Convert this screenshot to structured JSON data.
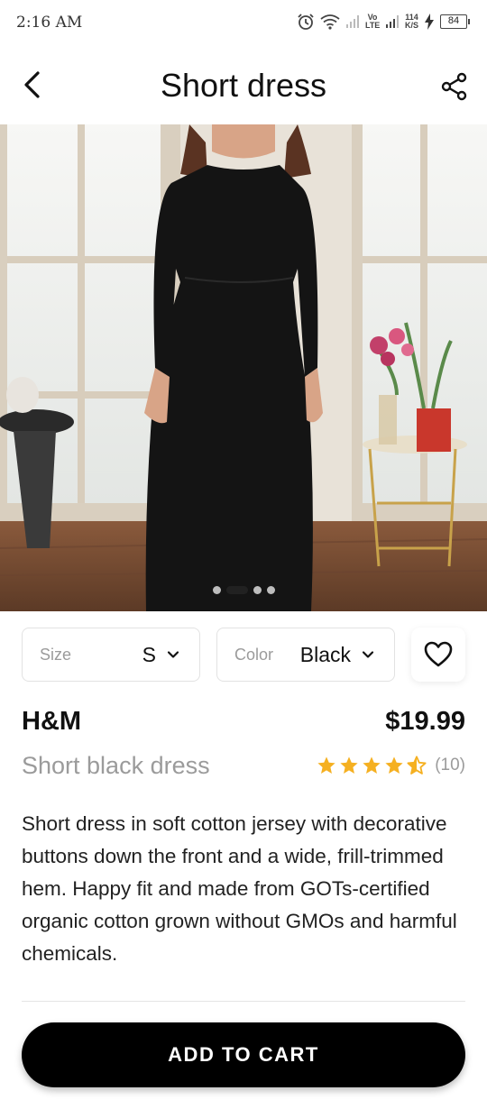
{
  "status_bar": {
    "time": "2:16 AM",
    "network_label": "Vo LTE",
    "speed_value": "114",
    "speed_unit": "K/S",
    "battery": "84"
  },
  "header": {
    "title": "Short dress",
    "back_icon": "chevron-left-icon",
    "share_icon": "share-icon"
  },
  "gallery": {
    "image_count": 4,
    "active_index": 1
  },
  "options": {
    "size_label": "Size",
    "size_value": "S",
    "color_label": "Color",
    "color_value": "Black",
    "favorite_icon": "heart-icon"
  },
  "product": {
    "brand": "H&M",
    "price": "$19.99",
    "subtitle": "Short black dress",
    "rating": 4.5,
    "rating_max": 5,
    "rating_count": "(10)",
    "star_color": "#f5b021",
    "description": "Short dress in soft cotton jersey with decorative buttons down the front and a wide, frill-trimmed hem. Happy fit and made from GOTs-certified organic cotton grown without GMOs and harmful chemicals."
  },
  "cart": {
    "button_label": "ADD TO CART"
  }
}
